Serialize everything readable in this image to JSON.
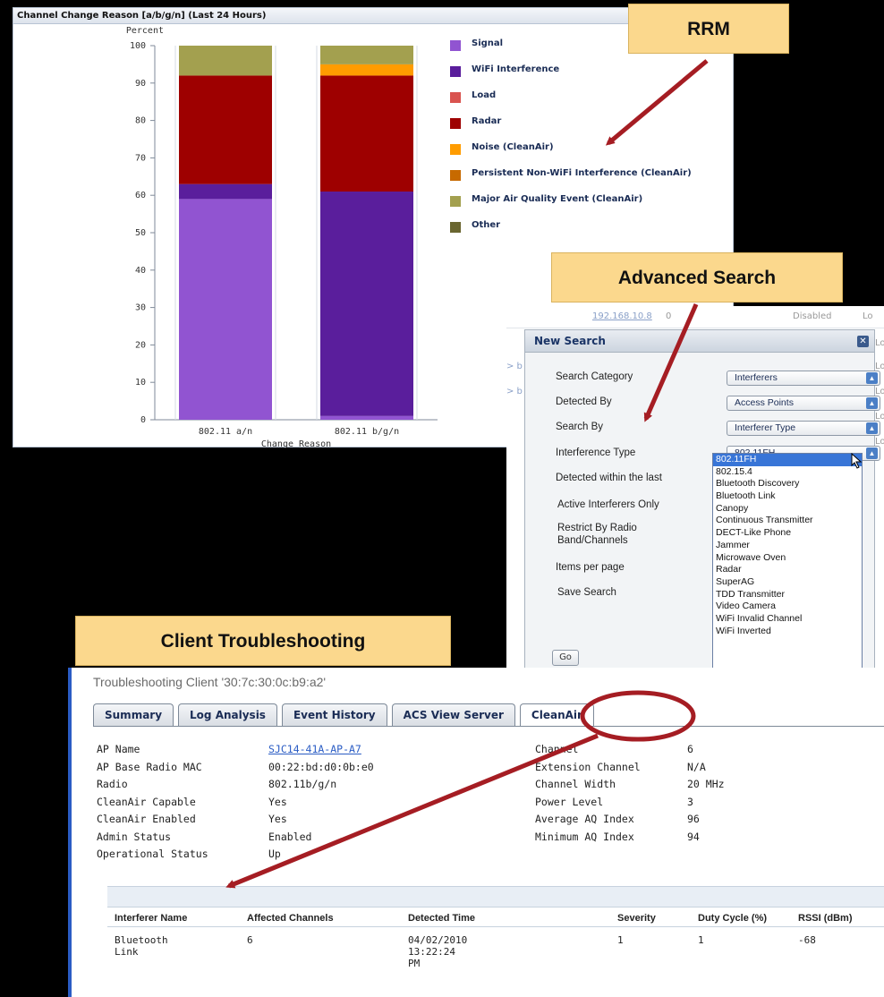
{
  "chart_panel": {
    "title": "Channel Change Reason [a/b/g/n] (Last 24 Hours)"
  },
  "chart_data": {
    "type": "bar",
    "stacked": true,
    "title": "Channel Change Reason [a/b/g/n] (Last 24 Hours)",
    "ylabel": "Percent",
    "xlabel": "Change Reason",
    "categories": [
      "802.11 a/n",
      "802.11 b/g/n"
    ],
    "ylim": [
      0,
      100
    ],
    "yticks": [
      0,
      10,
      20,
      30,
      40,
      50,
      60,
      70,
      80,
      90,
      100
    ],
    "series": [
      {
        "name": "Signal",
        "color": "#9154d1",
        "values": [
          59,
          1
        ]
      },
      {
        "name": "WiFi Interference",
        "color": "#5a1e9c",
        "values": [
          4,
          60
        ]
      },
      {
        "name": "Load",
        "color": "#d9534f",
        "values": [
          0,
          0
        ]
      },
      {
        "name": "Radar",
        "color": "#9e0000",
        "values": [
          29,
          31
        ]
      },
      {
        "name": "Noise (CleanAir)",
        "color": "#ff9c00",
        "values": [
          0,
          3
        ]
      },
      {
        "name": "Persistent Non-WiFi Interference (CleanAir)",
        "color": "#c76a00",
        "values": [
          0,
          0
        ]
      },
      {
        "name": "Major Air Quality Event (CleanAir)",
        "color": "#a3a04f",
        "values": [
          8,
          5
        ]
      },
      {
        "name": "Other",
        "color": "#6a6630",
        "values": [
          0,
          0
        ]
      }
    ]
  },
  "callouts": {
    "rrm": "RRM",
    "advanced_search": "Advanced Search",
    "client_troubleshooting": "Client Troubleshooting"
  },
  "search_panel": {
    "bg_row1": {
      "ip": "192.168.10.8",
      "col2": "0",
      "status": "Disabled",
      "col4": "Lo"
    },
    "bg_fragments": [
      "> b",
      "> b",
      "Lo",
      "Lo",
      "Lo",
      "Lo",
      "Lo"
    ],
    "dialog_title": "New Search",
    "close_label": "✕",
    "fields": [
      {
        "label": "Search Category",
        "value": "Interferers"
      },
      {
        "label": "Detected By",
        "value": "Access Points"
      },
      {
        "label": "Search By",
        "value": "Interferer Type"
      },
      {
        "label": "Interference Type",
        "value": "802.11FH"
      },
      {
        "label": "Detected within the last"
      },
      {
        "label": "Active Interferers Only"
      },
      {
        "label": "Restrict By Radio"
      },
      {
        "label": "Band/Channels"
      },
      {
        "label": "Items per page"
      },
      {
        "label": "Save Search"
      }
    ],
    "go_label": "Go",
    "dropdown_options": [
      "802.11FH",
      "802.15.4",
      "Bluetooth Discovery",
      "Bluetooth Link",
      "Canopy",
      "Continuous Transmitter",
      "DECT-Like Phone",
      "Jammer",
      "Microwave Oven",
      "Radar",
      "SuperAG",
      "TDD Transmitter",
      "Video Camera",
      "WiFi Invalid Channel",
      "WiFi Inverted"
    ]
  },
  "client": {
    "title": "Troubleshooting Client '30:7c:30:0c:b9:a2'",
    "tabs": [
      "Summary",
      "Log Analysis",
      "Event History",
      "ACS View Server",
      "CleanAir"
    ],
    "active_tab": "CleanAir",
    "left_fields": [
      {
        "label": "AP Name",
        "value": "SJC14-41A-AP-A7"
      },
      {
        "label": "AP Base Radio MAC",
        "value": "00:22:bd:d0:0b:e0"
      },
      {
        "label": "Radio",
        "value": "802.11b/g/n"
      },
      {
        "label": "CleanAir Capable",
        "value": "Yes"
      },
      {
        "label": "CleanAir Enabled",
        "value": "Yes"
      },
      {
        "label": "Admin Status",
        "value": "Enabled"
      },
      {
        "label": "Operational Status",
        "value": "Up"
      }
    ],
    "right_fields": [
      {
        "label": "Channel",
        "value": "6"
      },
      {
        "label": "Extension Channel",
        "value": "N/A"
      },
      {
        "label": "Channel Width",
        "value": "20 MHz"
      },
      {
        "label": "Power Level",
        "value": "3"
      },
      {
        "label": "Average AQ Index",
        "value": "96"
      },
      {
        "label": "Minimum AQ Index",
        "value": "94"
      }
    ],
    "table": {
      "headers": [
        "Interferer Name",
        "Affected Channels",
        "Detected Time",
        "Severity",
        "Duty Cycle (%)",
        "RSSI (dBm)"
      ],
      "rows": [
        [
          "Bluetooth Link",
          "6",
          "04/02/2010 13:22:24 PM",
          "1",
          "1",
          "-68"
        ]
      ]
    }
  }
}
